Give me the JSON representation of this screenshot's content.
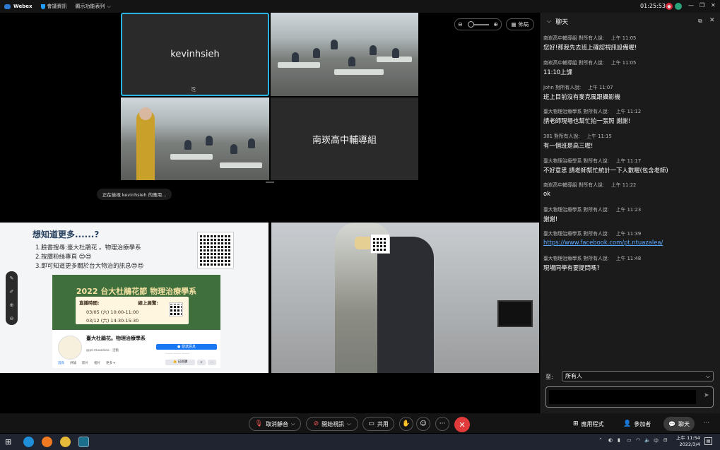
{
  "topbar": {
    "app_name": "Webex",
    "meeting_info": "會議資訊",
    "view_menu": "顯示功能表列",
    "timer": "01:25:53"
  },
  "tiles": {
    "tile1_name": "kevinhsieh",
    "tile4_name": "南崁高中輔導組"
  },
  "share_notice": "正在檢視 kevinhsieh 的應用...",
  "view_controls": {
    "layout_label": "佈局"
  },
  "shared_content": {
    "heading": "想知道更多......?",
    "lines": [
      "1.臉書搜尋:臺大杜鵑花 。物理治療學系",
      "2.按讚粉絲專頁 😍😍",
      "3.即可知道更多關於台大物治的訊息😍😍"
    ],
    "banner_title": "2022 台大杜鵑花節 物理治療學系",
    "banner_live": "直播時間:",
    "banner_exhibit": "線上展覽:",
    "banner_date1": "03/05 (六) 10:00-11:00",
    "banner_date2": "03/12 (六) 14:30-15:30",
    "fb_page_name": "臺大杜鵑花。物理治療學系",
    "fb_handle": "@pt.ntuazalea · 活動",
    "fb_button": "發送訊息",
    "fb_tabs": [
      "首頁",
      "評論",
      "影片",
      "相片",
      "更多 ▾"
    ],
    "fb_like": "已說讚"
  },
  "chat": {
    "title": "聊天",
    "messages": [
      {
        "sender": "南崁高中輔導組 對所有人說:",
        "time": "上午 11:05",
        "text": "您好!那我先去班上確認視訊設備喔!"
      },
      {
        "sender": "南崁高中輔導組 對所有人說:",
        "time": "上午 11:05",
        "text": "11:10上課"
      },
      {
        "sender": "John 對所有人說:",
        "time": "上午 11:07",
        "text": "班上目前沒有麥克風跟攝影機"
      },
      {
        "sender": "臺大物理治療學系 對所有人說:",
        "time": "上午 11:12",
        "text": "請老師現場也幫忙拍一張照 謝謝!"
      },
      {
        "sender": "301 對所有人說:",
        "time": "上午 11:15",
        "text": "有一個班是高三喔!"
      },
      {
        "sender": "臺大物理治療學系 對所有人說:",
        "time": "上午 11:17",
        "text": "不好意思 請老師幫忙統計一下人數喔(包含老師)"
      },
      {
        "sender": "南崁高中輔導組 對所有人說:",
        "time": "上午 11:22",
        "text": "ok"
      },
      {
        "sender": "臺大物理治療學系 對所有人說:",
        "time": "上午 11:23",
        "text": "謝謝!"
      },
      {
        "sender": "臺大物理治療學系 對所有人說:",
        "time": "上午 11:39",
        "text": "https://www.facebook.com/pt.ntuazalea/"
      },
      {
        "sender": "臺大物理治療學系 對所有人說:",
        "time": "上午 11:48",
        "text": "現場同學有要提問嗎?"
      }
    ],
    "to_label": "至:",
    "to_value": "所有人",
    "input_value": ""
  },
  "controls": {
    "unmute": "取消靜音",
    "start_video": "開始視訊",
    "share": "共用",
    "apps": "應用程式",
    "participants": "參加者",
    "chat": "聊天"
  },
  "taskbar": {
    "ime": "中",
    "time": "上午 11:54",
    "date": "2022/3/4"
  },
  "colors": {
    "accent": "#2bb3e6",
    "end_call": "#e03a3a",
    "link": "#5aa9ff"
  }
}
